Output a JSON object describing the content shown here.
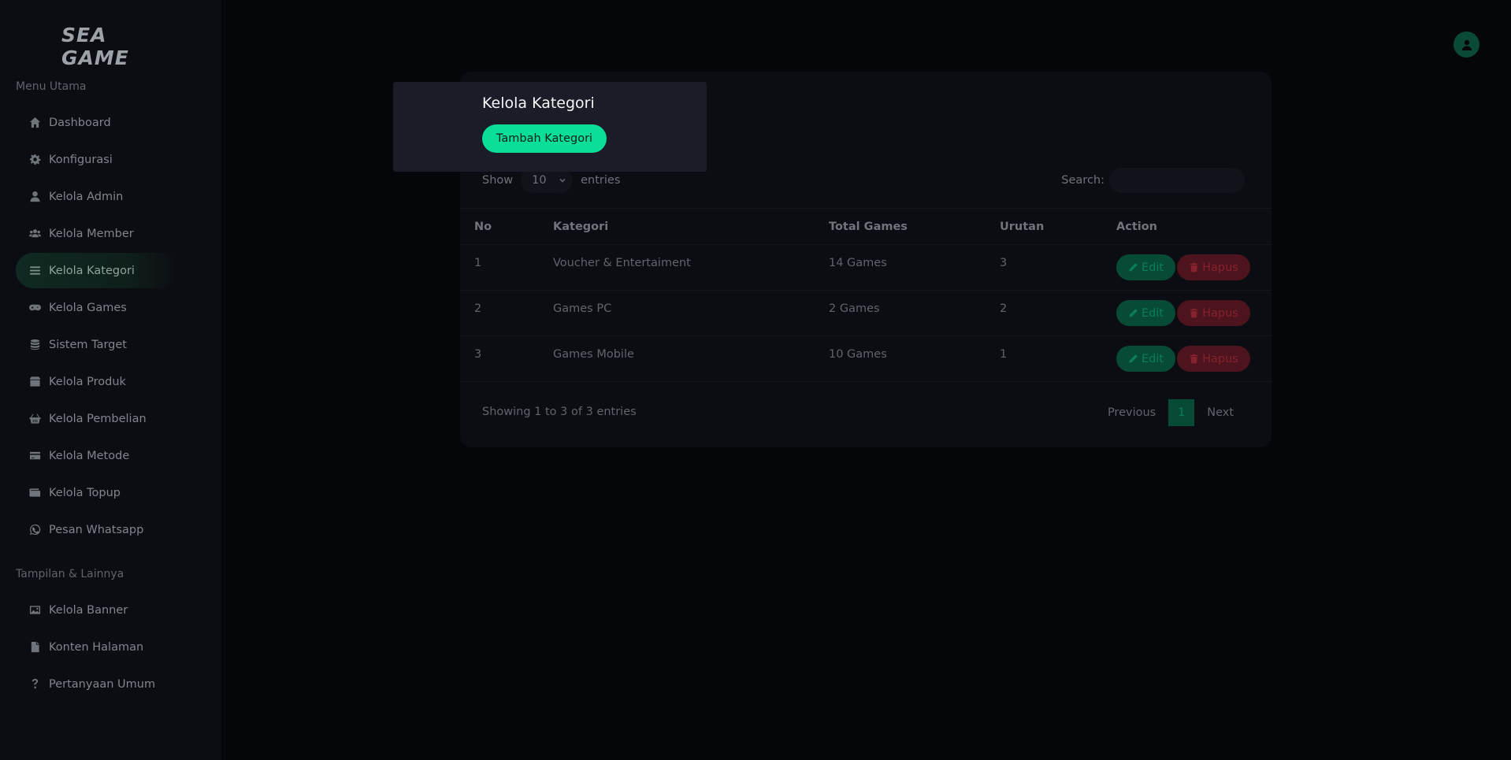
{
  "brand": {
    "logo_text": "SEA GAME"
  },
  "sidebar": {
    "section_main": "Menu Utama",
    "section_other": "Tampilan & Lainnya",
    "items": [
      {
        "label": "Dashboard",
        "icon": "home-icon"
      },
      {
        "label": "Konfigurasi",
        "icon": "gear-icon"
      },
      {
        "label": "Kelola Admin",
        "icon": "user-icon"
      },
      {
        "label": "Kelola Member",
        "icon": "users-icon"
      },
      {
        "label": "Kelola Kategori",
        "icon": "list-icon",
        "active": true
      },
      {
        "label": "Kelola Games",
        "icon": "gamepad-icon"
      },
      {
        "label": "Sistem Target",
        "icon": "database-icon"
      },
      {
        "label": "Kelola Produk",
        "icon": "box-icon"
      },
      {
        "label": "Kelola Pembelian",
        "icon": "basket-icon"
      },
      {
        "label": "Kelola Metode",
        "icon": "credit-card-icon"
      },
      {
        "label": "Kelola Topup",
        "icon": "wallet-icon"
      },
      {
        "label": "Pesan Whatsapp",
        "icon": "whatsapp-icon"
      }
    ],
    "items_other": [
      {
        "label": "Kelola Banner",
        "icon": "image-icon"
      },
      {
        "label": "Konten Halaman",
        "icon": "file-icon"
      },
      {
        "label": "Pertanyaan Umum",
        "icon": "question-icon"
      }
    ]
  },
  "header": {
    "title": "Kelola Kategori",
    "add_button": "Tambah Kategori"
  },
  "table_controls": {
    "show_label": "Show",
    "page_size": "10",
    "entries_label": "entries",
    "search_label": "Search:",
    "search_value": ""
  },
  "table": {
    "columns": [
      "No",
      "Kategori",
      "Total Games",
      "Urutan",
      "Action"
    ],
    "rows": [
      {
        "no": "1",
        "kategori": "Voucher & Entertaiment",
        "total": "14 Games",
        "urutan": "3"
      },
      {
        "no": "2",
        "kategori": "Games PC",
        "total": "2 Games",
        "urutan": "2"
      },
      {
        "no": "3",
        "kategori": "Games Mobile",
        "total": "10 Games",
        "urutan": "1"
      }
    ],
    "edit_label": "Edit",
    "delete_label": "Hapus"
  },
  "footer": {
    "info": "Showing 1 to 3 of 3 entries",
    "previous": "Previous",
    "page": "1",
    "next": "Next"
  },
  "colors": {
    "accent": "#0adf9a",
    "danger": "#86222f"
  }
}
